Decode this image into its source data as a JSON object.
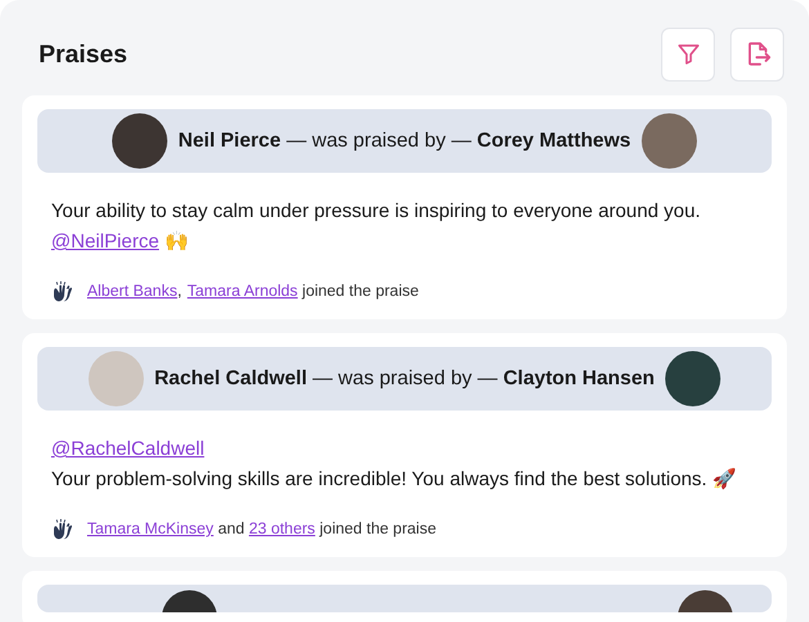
{
  "title": "Praises",
  "toolbar": [
    {
      "kind": "filter"
    },
    {
      "kind": "export"
    }
  ],
  "praises": [
    {
      "kind": "full",
      "recipient": "Neil Pierce",
      "connector": "— was praised by —",
      "giver": "Corey Matthews",
      "message_lines": [
        [
          {
            "kind": "text",
            "text": "Your ability to stay calm under pressure is inspiring to everyone around you."
          }
        ],
        [
          {
            "kind": "mention",
            "text": "@NeilPierce"
          },
          {
            "kind": "text",
            "text": " 🙌"
          }
        ]
      ],
      "joined": [
        {
          "kind": "link",
          "text": "Albert Banks",
          "punctuation": ","
        },
        {
          "kind": "link",
          "text": "Tamara Arnolds"
        },
        {
          "kind": "text",
          "text": " joined the praise"
        }
      ]
    },
    {
      "kind": "full",
      "recipient": "Rachel Caldwell",
      "connector": "— was praised by —",
      "giver": "Clayton Hansen",
      "message_lines": [
        [
          {
            "kind": "mention",
            "text": "@RachelCaldwell"
          }
        ],
        [
          {
            "kind": "text",
            "text": "Your problem-solving skills are incredible! You always find the best solutions. 🚀"
          }
        ]
      ],
      "joined": [
        {
          "kind": "link",
          "text": "Tamara McKinsey"
        },
        {
          "kind": "text",
          "text": " and "
        },
        {
          "kind": "link",
          "text": "23 others"
        },
        {
          "kind": "text",
          "text": " joined the praise"
        }
      ]
    },
    {
      "kind": "cut_off"
    }
  ]
}
